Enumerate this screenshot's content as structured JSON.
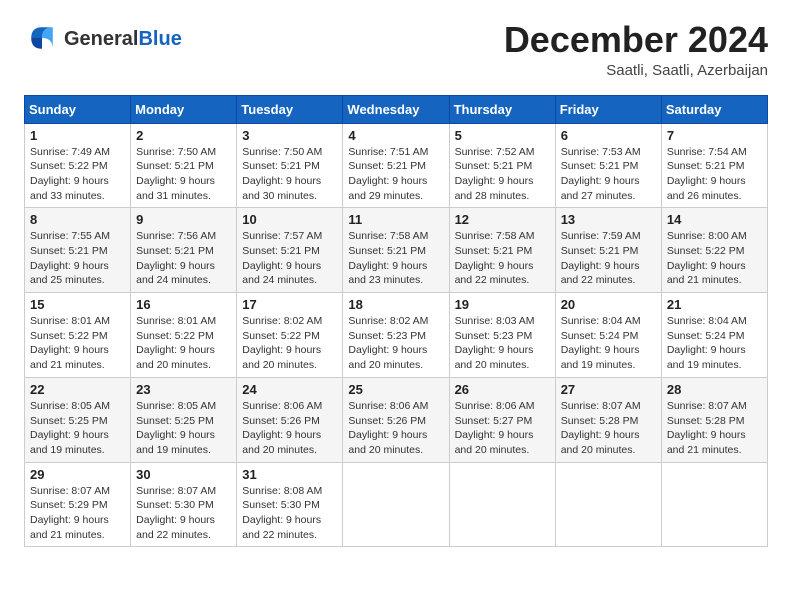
{
  "logo": {
    "general": "General",
    "blue": "Blue"
  },
  "title": {
    "month": "December 2024",
    "location": "Saatli, Saatli, Azerbaijan"
  },
  "weekdays": [
    "Sunday",
    "Monday",
    "Tuesday",
    "Wednesday",
    "Thursday",
    "Friday",
    "Saturday"
  ],
  "weeks": [
    [
      {
        "day": "1",
        "sunrise": "7:49 AM",
        "sunset": "5:22 PM",
        "daylight": "9 hours and 33 minutes."
      },
      {
        "day": "2",
        "sunrise": "7:50 AM",
        "sunset": "5:21 PM",
        "daylight": "9 hours and 31 minutes."
      },
      {
        "day": "3",
        "sunrise": "7:50 AM",
        "sunset": "5:21 PM",
        "daylight": "9 hours and 30 minutes."
      },
      {
        "day": "4",
        "sunrise": "7:51 AM",
        "sunset": "5:21 PM",
        "daylight": "9 hours and 29 minutes."
      },
      {
        "day": "5",
        "sunrise": "7:52 AM",
        "sunset": "5:21 PM",
        "daylight": "9 hours and 28 minutes."
      },
      {
        "day": "6",
        "sunrise": "7:53 AM",
        "sunset": "5:21 PM",
        "daylight": "9 hours and 27 minutes."
      },
      {
        "day": "7",
        "sunrise": "7:54 AM",
        "sunset": "5:21 PM",
        "daylight": "9 hours and 26 minutes."
      }
    ],
    [
      {
        "day": "8",
        "sunrise": "7:55 AM",
        "sunset": "5:21 PM",
        "daylight": "9 hours and 25 minutes."
      },
      {
        "day": "9",
        "sunrise": "7:56 AM",
        "sunset": "5:21 PM",
        "daylight": "9 hours and 24 minutes."
      },
      {
        "day": "10",
        "sunrise": "7:57 AM",
        "sunset": "5:21 PM",
        "daylight": "9 hours and 24 minutes."
      },
      {
        "day": "11",
        "sunrise": "7:58 AM",
        "sunset": "5:21 PM",
        "daylight": "9 hours and 23 minutes."
      },
      {
        "day": "12",
        "sunrise": "7:58 AM",
        "sunset": "5:21 PM",
        "daylight": "9 hours and 22 minutes."
      },
      {
        "day": "13",
        "sunrise": "7:59 AM",
        "sunset": "5:21 PM",
        "daylight": "9 hours and 22 minutes."
      },
      {
        "day": "14",
        "sunrise": "8:00 AM",
        "sunset": "5:22 PM",
        "daylight": "9 hours and 21 minutes."
      }
    ],
    [
      {
        "day": "15",
        "sunrise": "8:01 AM",
        "sunset": "5:22 PM",
        "daylight": "9 hours and 21 minutes."
      },
      {
        "day": "16",
        "sunrise": "8:01 AM",
        "sunset": "5:22 PM",
        "daylight": "9 hours and 20 minutes."
      },
      {
        "day": "17",
        "sunrise": "8:02 AM",
        "sunset": "5:22 PM",
        "daylight": "9 hours and 20 minutes."
      },
      {
        "day": "18",
        "sunrise": "8:02 AM",
        "sunset": "5:23 PM",
        "daylight": "9 hours and 20 minutes."
      },
      {
        "day": "19",
        "sunrise": "8:03 AM",
        "sunset": "5:23 PM",
        "daylight": "9 hours and 20 minutes."
      },
      {
        "day": "20",
        "sunrise": "8:04 AM",
        "sunset": "5:24 PM",
        "daylight": "9 hours and 19 minutes."
      },
      {
        "day": "21",
        "sunrise": "8:04 AM",
        "sunset": "5:24 PM",
        "daylight": "9 hours and 19 minutes."
      }
    ],
    [
      {
        "day": "22",
        "sunrise": "8:05 AM",
        "sunset": "5:25 PM",
        "daylight": "9 hours and 19 minutes."
      },
      {
        "day": "23",
        "sunrise": "8:05 AM",
        "sunset": "5:25 PM",
        "daylight": "9 hours and 19 minutes."
      },
      {
        "day": "24",
        "sunrise": "8:06 AM",
        "sunset": "5:26 PM",
        "daylight": "9 hours and 20 minutes."
      },
      {
        "day": "25",
        "sunrise": "8:06 AM",
        "sunset": "5:26 PM",
        "daylight": "9 hours and 20 minutes."
      },
      {
        "day": "26",
        "sunrise": "8:06 AM",
        "sunset": "5:27 PM",
        "daylight": "9 hours and 20 minutes."
      },
      {
        "day": "27",
        "sunrise": "8:07 AM",
        "sunset": "5:28 PM",
        "daylight": "9 hours and 20 minutes."
      },
      {
        "day": "28",
        "sunrise": "8:07 AM",
        "sunset": "5:28 PM",
        "daylight": "9 hours and 21 minutes."
      }
    ],
    [
      {
        "day": "29",
        "sunrise": "8:07 AM",
        "sunset": "5:29 PM",
        "daylight": "9 hours and 21 minutes."
      },
      {
        "day": "30",
        "sunrise": "8:07 AM",
        "sunset": "5:30 PM",
        "daylight": "9 hours and 22 minutes."
      },
      {
        "day": "31",
        "sunrise": "8:08 AM",
        "sunset": "5:30 PM",
        "daylight": "9 hours and 22 minutes."
      },
      null,
      null,
      null,
      null
    ]
  ]
}
